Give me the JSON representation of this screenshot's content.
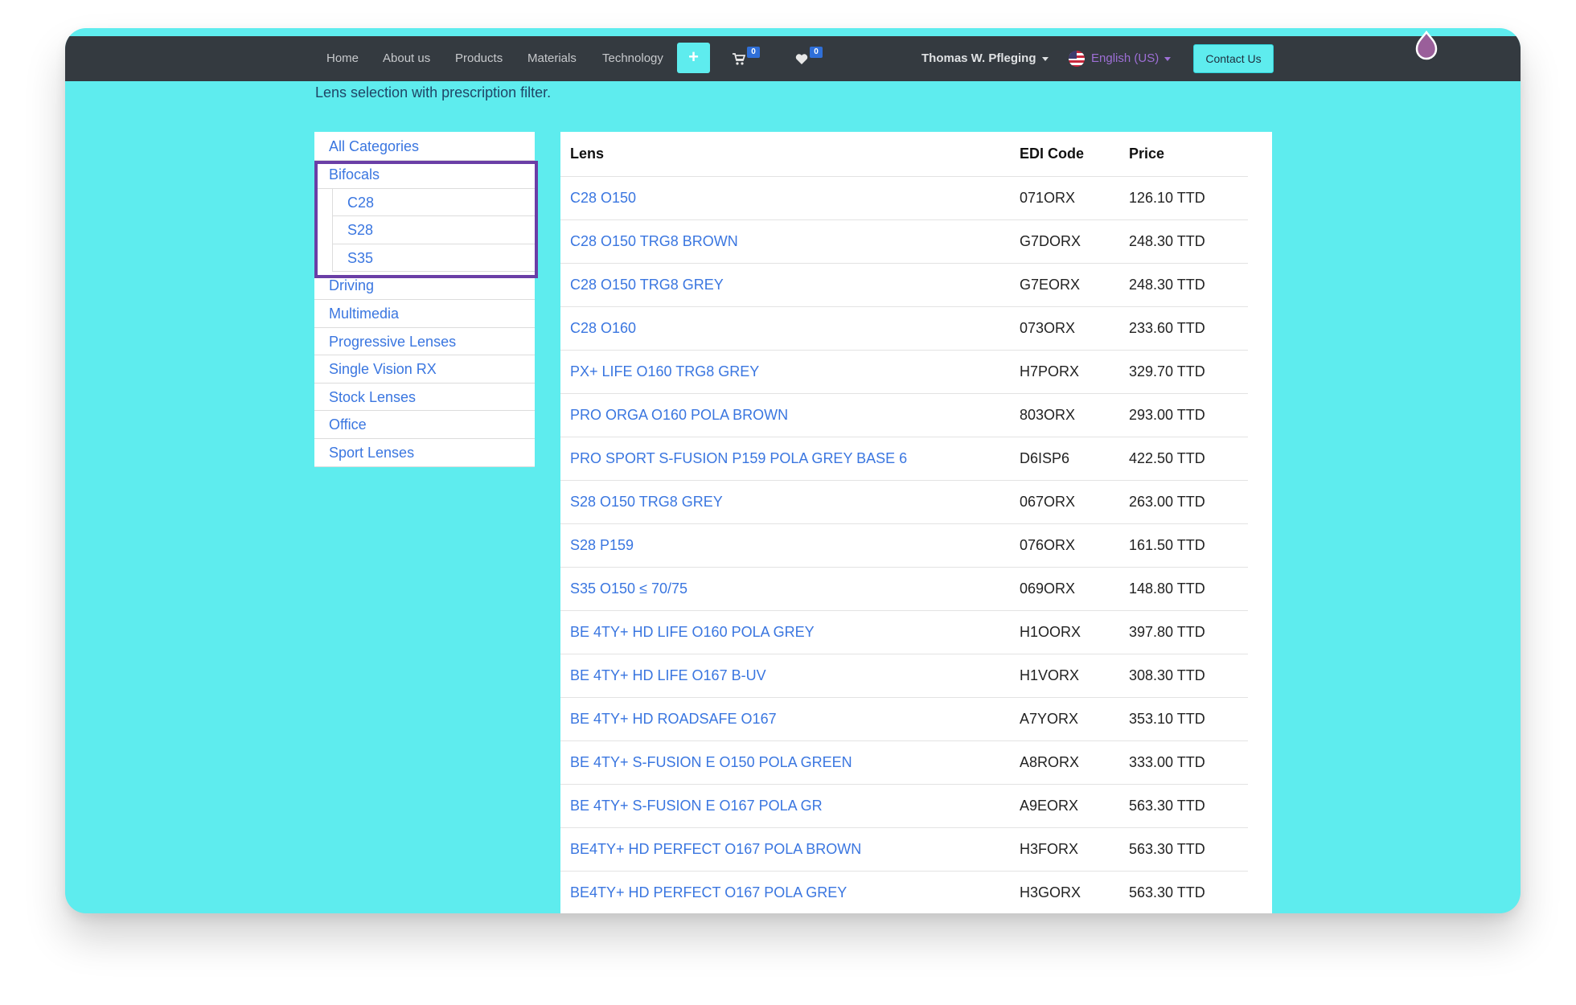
{
  "navbar": {
    "items": [
      "Home",
      "About us",
      "Products",
      "Materials",
      "Technology"
    ],
    "plus_label": "+",
    "cart_count": "0",
    "wishlist_count": "0",
    "user_name": "Thomas W. Pfleging",
    "language": "English (US)",
    "contact_label": "Contact Us"
  },
  "subtitle": "Lens selection with prescription filter.",
  "categories": {
    "all": "All Categories",
    "bifocals": "Bifocals",
    "bifocal_subs": [
      "C28",
      "S28",
      "S35"
    ],
    "others": [
      "Driving",
      "Multimedia",
      "Progressive Lenses",
      "Single Vision RX",
      "Stock Lenses",
      "Office",
      "Sport Lenses"
    ]
  },
  "table": {
    "headers": [
      "Lens",
      "EDI Code",
      "Price"
    ],
    "rows": [
      {
        "lens": "C28 O150",
        "edi": "071ORX",
        "price": "126.10 TTD"
      },
      {
        "lens": "C28 O150 TRG8 BROWN",
        "edi": "G7DORX",
        "price": "248.30 TTD"
      },
      {
        "lens": "C28 O150 TRG8 GREY",
        "edi": "G7EORX",
        "price": "248.30 TTD"
      },
      {
        "lens": "C28 O160",
        "edi": "073ORX",
        "price": "233.60 TTD"
      },
      {
        "lens": "PX+ LIFE O160 TRG8 GREY",
        "edi": "H7PORX",
        "price": "329.70 TTD"
      },
      {
        "lens": "PRO ORGA O160 POLA BROWN",
        "edi": "803ORX",
        "price": "293.00 TTD"
      },
      {
        "lens": "PRO SPORT S-FUSION P159 POLA GREY BASE 6",
        "edi": "D6ISP6",
        "price": "422.50 TTD"
      },
      {
        "lens": "S28 O150 TRG8 GREY",
        "edi": "067ORX",
        "price": "263.00 TTD"
      },
      {
        "lens": "S28 P159",
        "edi": "076ORX",
        "price": "161.50 TTD"
      },
      {
        "lens": "S35 O150 ≤ 70/75",
        "edi": "069ORX",
        "price": "148.80 TTD"
      },
      {
        "lens": "BE 4TY+ HD LIFE O160 POLA GREY",
        "edi": "H1OORX",
        "price": "397.80 TTD"
      },
      {
        "lens": "BE 4TY+ HD LIFE O167 B-UV",
        "edi": "H1VORX",
        "price": "308.30 TTD"
      },
      {
        "lens": "BE 4TY+ HD ROADSAFE O167",
        "edi": "A7YORX",
        "price": "353.10 TTD"
      },
      {
        "lens": "BE 4TY+ S-FUSION E O150 POLA GREEN",
        "edi": "A8RORX",
        "price": "333.00 TTD"
      },
      {
        "lens": "BE 4TY+ S-FUSION E O167 POLA GR",
        "edi": "A9EORX",
        "price": "563.30 TTD"
      },
      {
        "lens": "BE4TY+ HD PERFECT O167 POLA BROWN",
        "edi": "H3FORX",
        "price": "563.30 TTD"
      },
      {
        "lens": "BE4TY+ HD PERFECT O167 POLA GREY",
        "edi": "H3GORX",
        "price": "563.30 TTD"
      }
    ]
  },
  "colors": {
    "background": "#5eecee",
    "navbar": "#343a40",
    "link": "#3a76e0",
    "highlight": "#6a3ea6",
    "badge": "#2f6fd8"
  },
  "icons": [
    "cart-icon",
    "heart-icon",
    "us-flag-icon",
    "drop-icon",
    "caret-down-icon",
    "plus-icon"
  ]
}
